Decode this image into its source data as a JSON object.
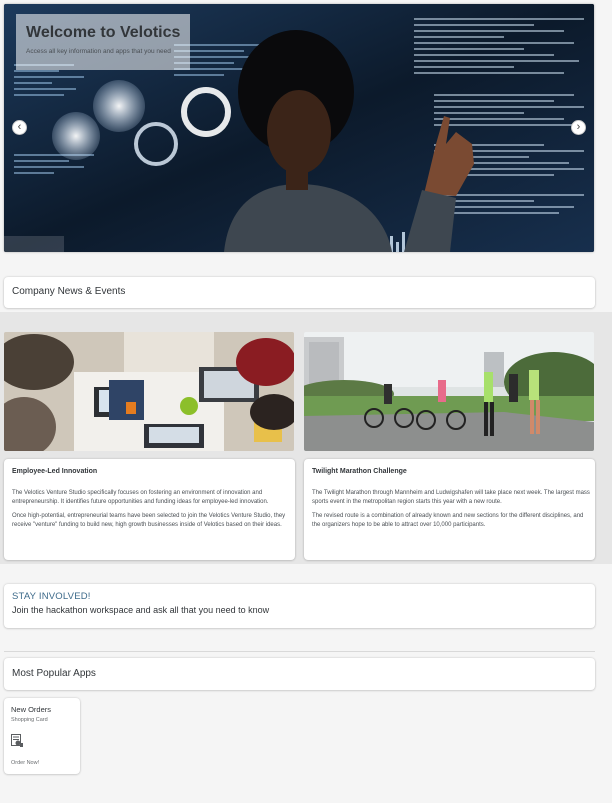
{
  "hero": {
    "title": "Welcome to Velotics",
    "subtitle": "Access all key information and apps that you need",
    "prev_label": "‹",
    "next_label": "›"
  },
  "news_section": {
    "title": "Company News & Events"
  },
  "news_items": [
    {
      "title": "Employee-Led Innovation",
      "paragraphs": [
        "The Velotics Venture Studio specifically focuses on fostering an environment of innovation and entrepreneurship. It identifies future opportunities and funding ideas for employee-led innovation.",
        "Once high-potential, entrepreneurial teams have been selected to join the Velotics Venture Studio, they receive \"venture\" funding to build new, high growth businesses inside of Velotics based on their ideas."
      ]
    },
    {
      "title": "Twilight Marathon Challenge",
      "paragraphs": [
        "The Twilight Marathon through Mannheim and Ludwigshafen will take place next week. The largest mass sports event in the metropolitan region starts this year with a new route.",
        "The revised route is a combination of already known and new sections for the different disciplines, and the organizers hope to be able to attract over 10,000 participants."
      ]
    }
  ],
  "involved": {
    "title": "STAY INVOLVED!",
    "text": "Join the hackathon workspace and ask all that you need to know"
  },
  "apps_section": {
    "title": "Most Popular Apps"
  },
  "app_tiles": [
    {
      "title": "New Orders",
      "subtitle": "Shopping Card",
      "icon": "shopping-cart-icon",
      "footer": "Order Now!"
    }
  ],
  "colors": {
    "accent": "#3d6a8a",
    "background": "#f5f5f5",
    "card": "#ffffff"
  }
}
